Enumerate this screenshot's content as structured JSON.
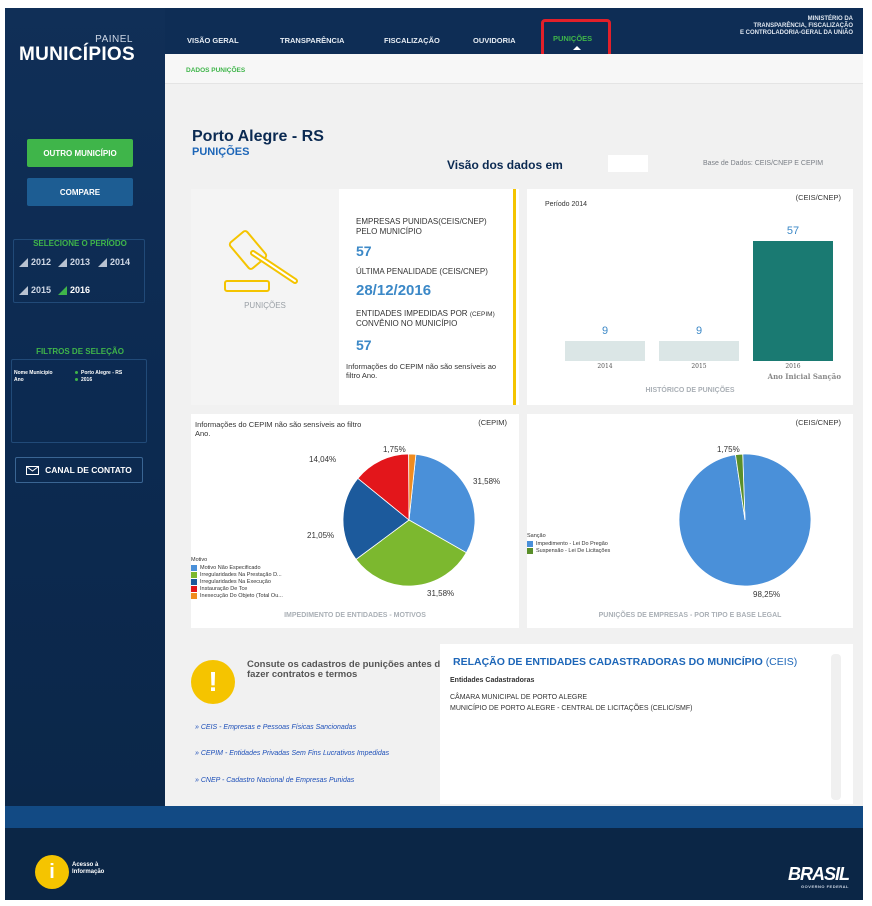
{
  "header": {
    "logo_small": "PAINEL",
    "logo_big": "MUNICÍPIOS",
    "ministerio_line1": "MINISTÉRIO DA",
    "ministerio_line2": "TRANSPARÊNCIA, FISCALIZAÇÃO",
    "ministerio_line3": "E CONTROLADORIA-GERAL DA UNIÃO",
    "nav": [
      "VISÃO GERAL",
      "TRANSPARÊNCIA",
      "FISCALIZAÇÃO",
      "OUVIDORIA",
      "PUNIÇÕES"
    ],
    "active_nav": "PUNIÇÕES"
  },
  "sidebar": {
    "outro_button": "OUTRO MUNICÍPIO",
    "compare_button": "COMPARE",
    "periodo_title": "SELECIONE O PERÍODO",
    "years": [
      "2012",
      "2013",
      "2014",
      "2015",
      "2016"
    ],
    "selected_year": "2016",
    "filtros_title": "FILTROS DE SELEÇÃO",
    "filtro_labels": [
      "Nome Município",
      "Ano"
    ],
    "filtro_values": [
      "Porto Alegre - RS",
      "2016"
    ],
    "canal_button": "CANAL DE CONTATO"
  },
  "main": {
    "subbar_label": "DADOS PUNIÇÕES",
    "city": "Porto Alegre - RS",
    "city_sub": "PUNIÇÕES",
    "visao": "Visão dos dados em",
    "base": "Base de Dados: CEIS/CNEP E CEPIM"
  },
  "kpi": {
    "icon_label": "PUNIÇÕES",
    "label1": "EMPRESAS PUNIDAS(CEIS/CNEP) PELO MUNICÍPIO",
    "value1": "57",
    "label2": "ÚLTIMA PENALIDADE (CEIS/CNEP)",
    "value2": "28/12/2016",
    "label3": "ENTIDADES IMPEDIDAS POR",
    "label3_tag": "(CEPIM)",
    "label3b": "CONVÊNIO NO MUNICÍPIO",
    "value3": "57",
    "note": "Informações do CEPIM não são sensíveis ao filtro Ano."
  },
  "historico": {
    "tag": "(CEIS/CNEP)",
    "periodo": "Período 2014",
    "axis_label": "Ano Inicial Sanção",
    "title": "HISTÓRICO DE PUNIÇÕES"
  },
  "motivos": {
    "tag": "(CEPIM)",
    "note": "Informações do CEPIM não são sensíveis ao filtro Ano.",
    "legend_title": "Motivo",
    "title": "IMPEDIMENTO DE ENTIDADES - MOTIVOS"
  },
  "tipo": {
    "tag": "(CEIS/CNEP)",
    "legend_title": "Sanção",
    "title": "PUNIÇÕES DE EMPRESAS - POR TIPO E BASE LEGAL"
  },
  "chart_data": [
    {
      "type": "bar",
      "categories": [
        "2014",
        "2015",
        "2016"
      ],
      "values": [
        9,
        9,
        57
      ],
      "xlabel": "Ano Inicial Sanção",
      "colors": [
        "#dbe6e6",
        "#dbe6e6",
        "#1a7a72"
      ],
      "title": "HISTÓRICO DE PUNIÇÕES"
    },
    {
      "type": "pie",
      "labels": [
        "Motivo Não Especificado",
        "Irregularidades Na Prestação D...",
        "Irregularidades Na Execução",
        "Instauração De Tce",
        "Inexecução Do Objeto (Total Ou..."
      ],
      "values": [
        31.58,
        31.58,
        21.05,
        14.04,
        1.75
      ],
      "display": [
        "31,58%",
        "31,58%",
        "21,05%",
        "14,04%",
        "1,75%"
      ],
      "colors": [
        "#4a90d9",
        "#7cb82f",
        "#1c5a9c",
        "#e3161b",
        "#f08c1f"
      ],
      "title": "IMPEDIMENTO DE ENTIDADES - MOTIVOS"
    },
    {
      "type": "pie",
      "labels": [
        "Impedimento - Lei Do Pregão",
        "Suspensão - Lei De Licitações"
      ],
      "values": [
        98.25,
        1.75
      ],
      "display": [
        "98,25%",
        "1,75%"
      ],
      "colors": [
        "#4a90d9",
        "#5a8f2a"
      ],
      "title": "PUNIÇÕES DE EMPRESAS - POR TIPO E BASE LEGAL"
    }
  ],
  "consulte": {
    "text": "Consute os cadastros de punições antes de fazer contratos e termos",
    "links": [
      "» CEIS - Empresas e Pessoas Físicas Sancionadas",
      "» CEPIM - Entidades Privadas Sem Fins Lucrativos Impedidas",
      "» CNEP - Cadastro Nacional de Empresas Punidas"
    ]
  },
  "relacao": {
    "title": "RELAÇÃO DE ENTIDADES CADASTRADORAS DO MUNICÍPIO",
    "title_tag": "(CEIS)",
    "header": "Entidades Cadastradoras",
    "items": [
      "CÂMARA MUNICIPAL DE PORTO ALEGRE",
      "MUNICÍPIO DE PORTO ALEGRE - CENTRAL DE LICITAÇÕES (CELIC/SMF)"
    ]
  },
  "footer": {
    "acesso_line1": "Acesso à",
    "acesso_line2": "Informação",
    "brasil": "BRASIL",
    "brasil_sub": "GOVERNO FEDERAL",
    "acesso_icon": "i"
  }
}
